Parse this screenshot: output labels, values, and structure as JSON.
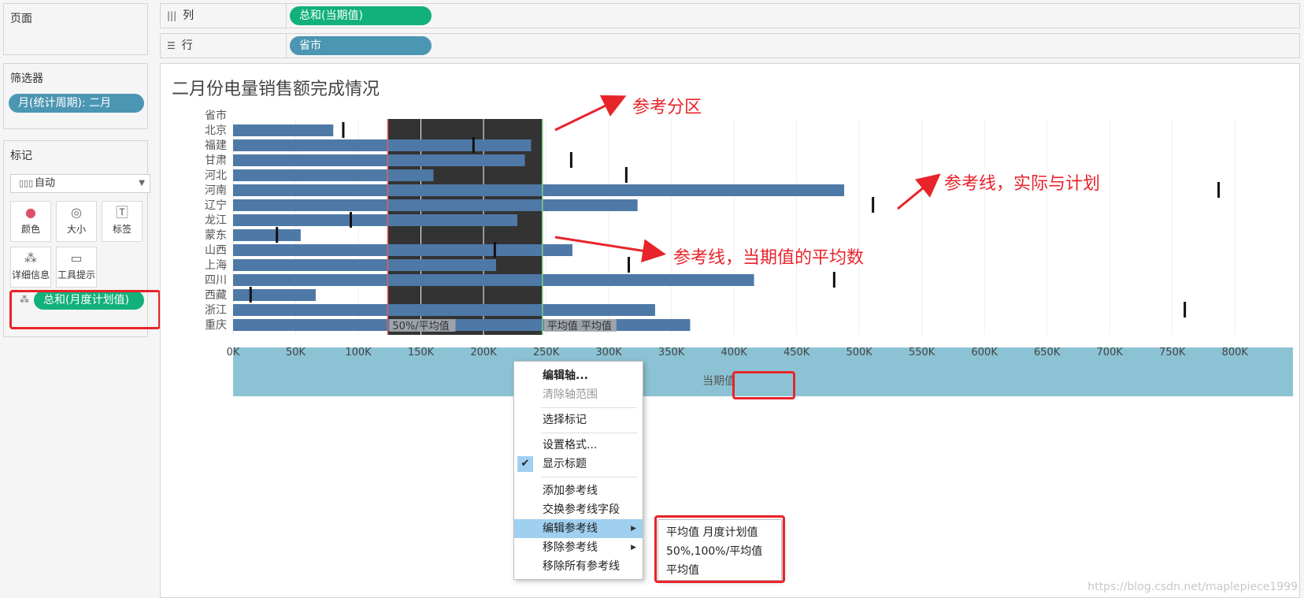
{
  "left": {
    "pages_title": "页面",
    "filters_title": "筛选器",
    "filter_pill": "月(统计周期): 二月",
    "marks_title": "标记",
    "mark_type": "自动",
    "mark_buttons": {
      "color": "颜色",
      "size": "大小",
      "label": "标签",
      "detail": "详细信息",
      "tooltip": "工具提示"
    },
    "detail_pill": "总和(月度计划值)"
  },
  "shelves": {
    "columns_label": "列",
    "columns_pill": "总和(当期值)",
    "rows_label": "行",
    "rows_pill": "省市"
  },
  "view": {
    "title": "二月份电量销售额完成情况",
    "axis_title": "当期值",
    "annotations": {
      "ref_band": "参考分区",
      "ref_line_plan": "参考线，实际与计划",
      "ref_line_avg": "参考线，当期值的平均数"
    }
  },
  "chart_data": {
    "type": "bar",
    "orientation": "horizontal",
    "row_header": "省市",
    "categories": [
      "北京",
      "福建",
      "甘肃",
      "河北",
      "河南",
      "辽宁",
      "龙江",
      "蒙东",
      "山西",
      "上海",
      "四川",
      "西藏",
      "浙江",
      "重庆"
    ],
    "values": [
      80000,
      238000,
      233000,
      160000,
      488000,
      323000,
      227000,
      54000,
      271000,
      210000,
      416000,
      66000,
      337000,
      365000
    ],
    "reference_marks": [
      88000,
      192000,
      270000,
      314000,
      787000,
      511000,
      94000,
      35000,
      209000,
      316000,
      480000,
      14000,
      760000,
      0
    ],
    "reference_band": {
      "from": 123500,
      "to": 247000,
      "band_label": "50%/平均值",
      "line_label": "平均值 平均值",
      "inner_lines": [
        150000,
        200000
      ]
    },
    "xlim": [
      0,
      825000
    ],
    "ticks": [
      0,
      50000,
      100000,
      150000,
      200000,
      250000,
      300000,
      350000,
      400000,
      450000,
      500000,
      550000,
      600000,
      650000,
      700000,
      750000,
      800000
    ],
    "tick_labels": [
      "0K",
      "50K",
      "100K",
      "150K",
      "200K",
      "250K",
      "300K",
      "350K",
      "400K",
      "450K",
      "500K",
      "550K",
      "600K",
      "650K",
      "700K",
      "750K",
      "800K"
    ],
    "xlabel": "当期值",
    "bar_color": "#4e79a7",
    "band_color": "#333333",
    "grid": true
  },
  "context_menu": {
    "items": [
      "编辑轴...",
      "清除轴范围",
      "选择标记",
      "设置格式...",
      "显示标题",
      "添加参考线",
      "交换参考线字段",
      "编辑参考线",
      "移除参考线",
      "移除所有参考线"
    ],
    "submenu": [
      "平均值 月度计划值",
      "50%,100%/平均值",
      "平均值"
    ]
  },
  "watermark": "https://blog.csdn.net/maplepiece1999"
}
